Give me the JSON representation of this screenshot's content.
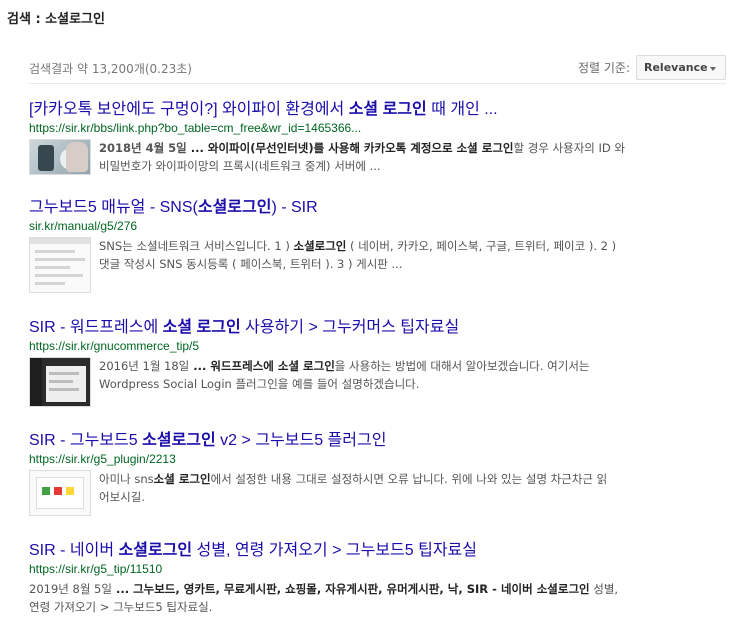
{
  "page": {
    "heading": "검색 : 소셜로그인"
  },
  "stats": {
    "text": "검색결과 약 13,200개(0.23초)"
  },
  "sort": {
    "label": "정렬 기준:",
    "selected": "Relevance"
  },
  "results": [
    {
      "title_parts": [
        "[카카오톡 보안에도 구멍이?] 와이파이 환경에서 ",
        "소셜 로그인",
        " 때 개인 ..."
      ],
      "url": "https://sir.kr/bbs/link.php?bo_table=cm_free&wr_id=1465366...",
      "date": "2018년 4월 5일",
      "snippet_parts": [
        " ... 와이파이(무선인터넷)를 사용해 카카오톡 계정으로 ",
        "소셜 로그인",
        "할 경우 사용자의 ID 와",
        "비밀번호가 와이파이망의 프록시(네트워크 중계) 서버에 ..."
      ]
    },
    {
      "title_parts": [
        "그누보드5 매뉴얼 - SNS(",
        "소셜로그인",
        ") - SIR"
      ],
      "url": "sir.kr/manual/g5/276",
      "snippet_parts": [
        "SNS는 소셜네트워크 서비스입니다. 1 ) ",
        "소셜로그인",
        " ( 네이버, 카카오, 페이스북, 구글, 트위터, 페이코 ). 2 )",
        "댓글 작성시 SNS 동시등록 ( 페이스북, 트위터 ). 3 ) 게시판 ..."
      ]
    },
    {
      "title_parts": [
        "SIR - 워드프레스에 ",
        "소셜 로그인",
        " 사용하기 > 그누커머스 팁자료실"
      ],
      "url": "https://sir.kr/gnucommerce_tip/5",
      "date": "2016년 1월 18일",
      "snippet_parts": [
        " ... 워드프레스에 ",
        "소셜 로그인",
        "을 사용하는 방법에 대해서 알아보겠습니다. 여기서는",
        "Wordpress Social Login 플러그인을 예를 들어 설명하겠습니다."
      ]
    },
    {
      "title_parts": [
        "SIR - 그누보드5 ",
        "소셜로그인",
        " v2 > 그누보드5 플러그인"
      ],
      "url": "https://sir.kr/g5_plugin/2213",
      "snippet_parts": [
        "아미나 sns",
        "소셜 로그인",
        "에서 설정한 내용 그대로 설정하시면 오류 납니다. 위에 나와 있는 설명 차근차근 읽",
        "어보시길."
      ]
    },
    {
      "title_parts": [
        "SIR - 네이버 ",
        "소셜로그인",
        " 성별, 연령 가져오기 > 그누보드5 팁자료실"
      ],
      "url": "https://sir.kr/g5_tip/11510",
      "date": "2019년 8월 5일",
      "snippet_parts": [
        " ... 그누보드, 영카트, 무료게시판, 쇼핑몰, 자유게시판, 유머게시판, 낙, SIR - 네이버 ",
        "소셜로그인",
        " 성별,",
        "연령 가져오기 > 그누보드5 팁자료실."
      ]
    }
  ]
}
